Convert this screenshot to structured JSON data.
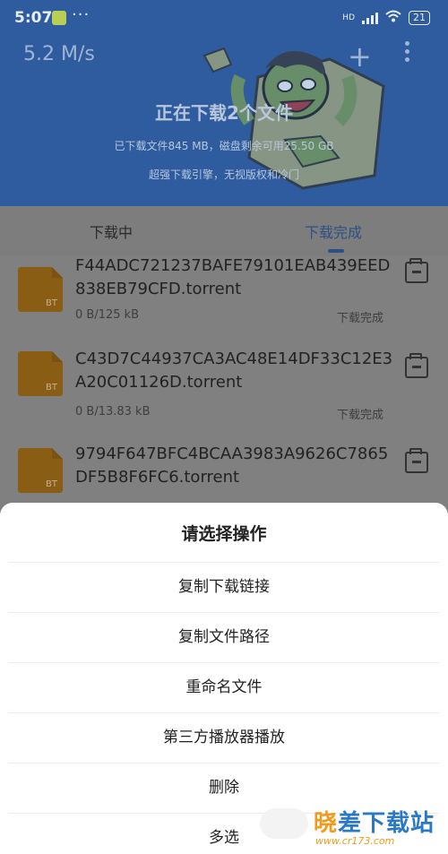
{
  "status_bar": {
    "time": "5:07",
    "dots": "···",
    "network": "HD",
    "battery": "21"
  },
  "header": {
    "speed": "5.2 M/s",
    "title": "正在下载2个文件",
    "subtitle": "已下载文件845 MB，磁盘剩余可用25.50 GB",
    "slogan": "超强下载引擎，无视版权和冷门",
    "accent_color": "#2e5c9f"
  },
  "tabs": [
    {
      "label": "下载中",
      "active": false
    },
    {
      "label": "下载完成",
      "active": true
    }
  ],
  "files": [
    {
      "name": "F44ADC721237BAFE79101EAB439EED838EB79CFD.torrent",
      "size": "0 B/125 kB",
      "status": "下载完成",
      "badge": "BT"
    },
    {
      "name": "C43D7C44937CA3AC48E14DF33C12E3A20C01126D.torrent",
      "size": "0 B/13.83 kB",
      "status": "下载完成",
      "badge": "BT"
    },
    {
      "name": "9794F647BFC4BCAA3983A9626C7865DF5B8F6FC6.torrent",
      "size": "",
      "status": "",
      "badge": "BT"
    }
  ],
  "action_sheet": {
    "title": "请选择操作",
    "options": [
      "复制下载链接",
      "复制文件路径",
      "重命名文件",
      "第三方播放器播放",
      "删除",
      "多选"
    ]
  },
  "watermark": {
    "text_a": "晓",
    "text_b": "差下载站",
    "url": "www.cr173.com"
  }
}
